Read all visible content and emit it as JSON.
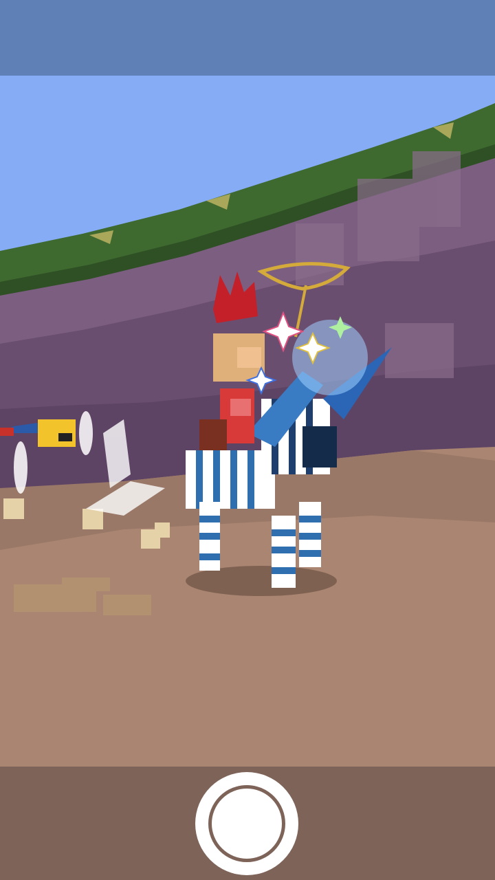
{
  "screen": "photo-mode",
  "scene": {
    "description_icon": "zebra-unicorn-rider",
    "sky_color": "#86acf5",
    "wall_color": "#6e5373",
    "ground_color": "#a98572",
    "hedge_color": "#3e6a2f"
  },
  "controls": {
    "shutter_icon": "camera-shutter-icon"
  }
}
